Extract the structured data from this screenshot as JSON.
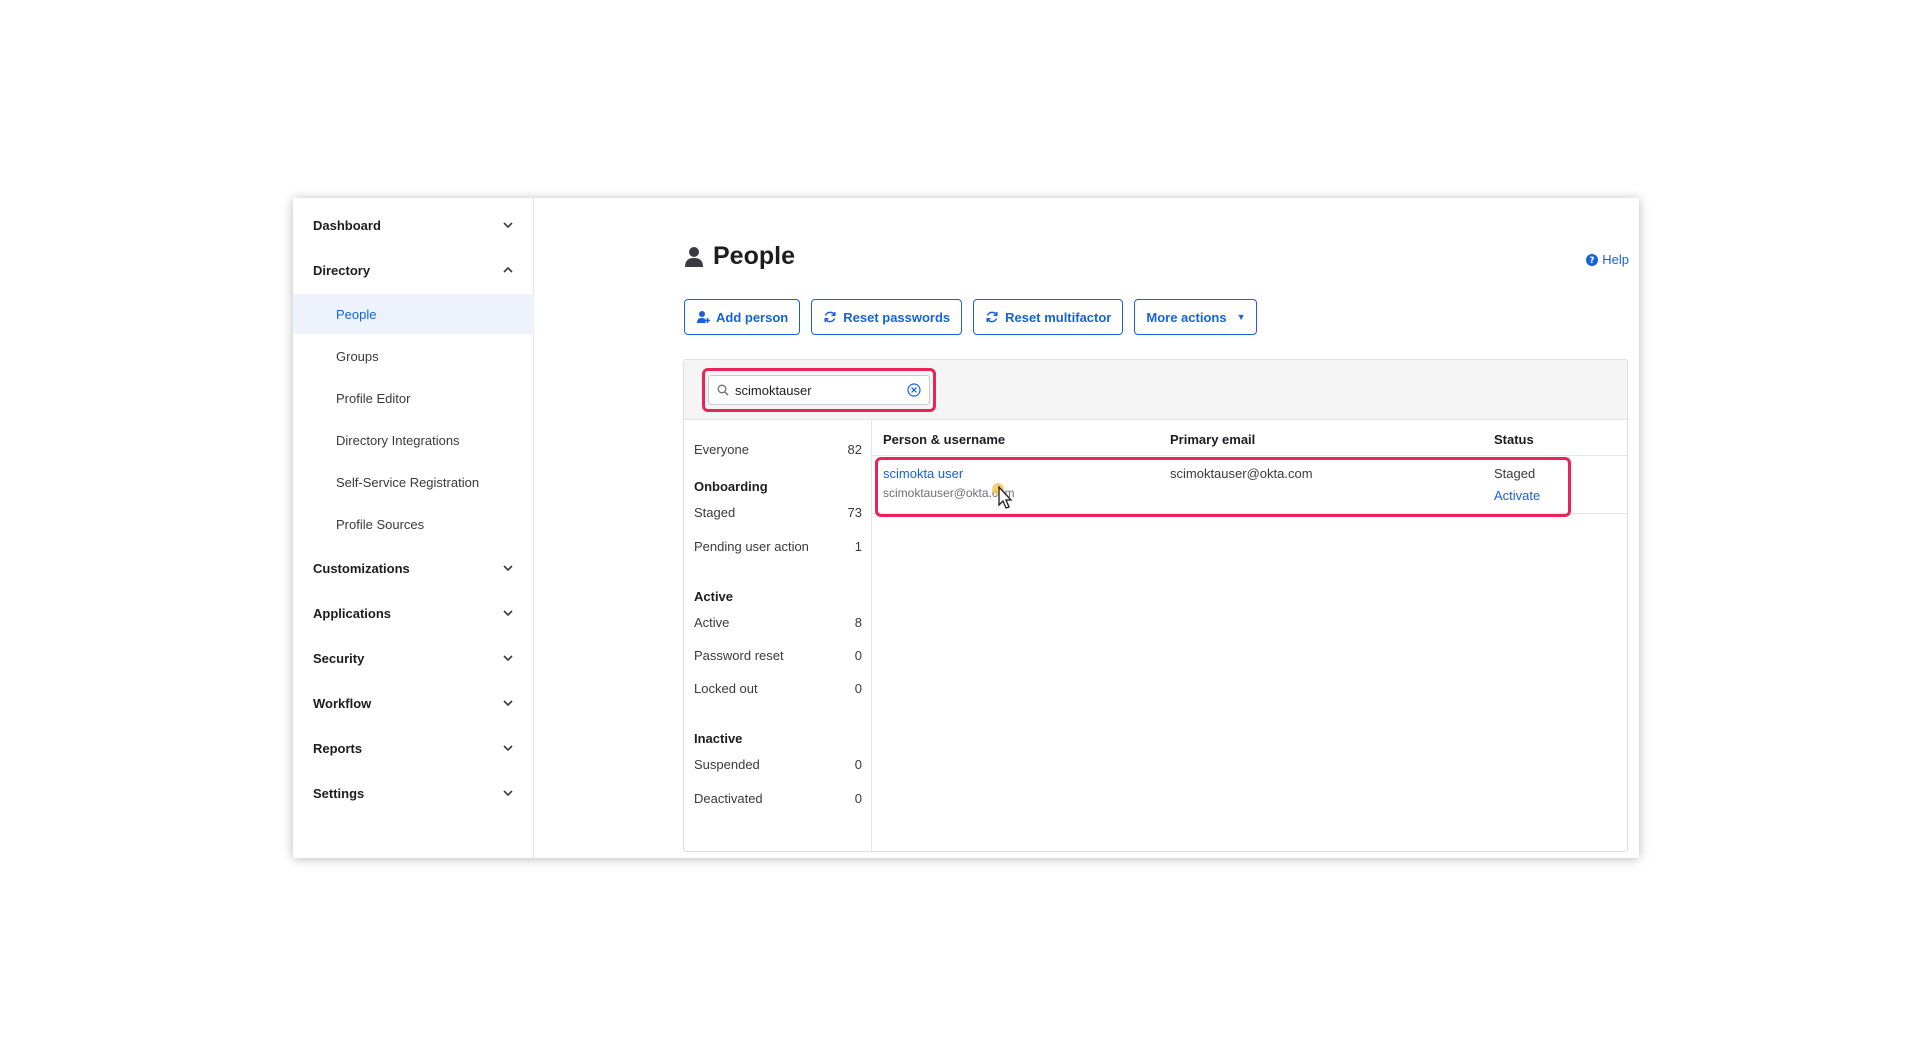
{
  "sidebar": {
    "sections": [
      {
        "label": "Dashboard"
      },
      {
        "label": "Directory"
      },
      {
        "label": "Customizations"
      },
      {
        "label": "Applications"
      },
      {
        "label": "Security"
      },
      {
        "label": "Workflow"
      },
      {
        "label": "Reports"
      },
      {
        "label": "Settings"
      }
    ],
    "directory_items": [
      {
        "label": "People"
      },
      {
        "label": "Groups"
      },
      {
        "label": "Profile Editor"
      },
      {
        "label": "Directory Integrations"
      },
      {
        "label": "Self-Service Registration"
      },
      {
        "label": "Profile Sources"
      }
    ],
    "active_item": "People"
  },
  "header": {
    "title": "People",
    "help_label": "Help",
    "title_icon": "person-icon",
    "help_icon": "question-circle-icon"
  },
  "toolbar": {
    "add_person": "Add person",
    "reset_passwords": "Reset passwords",
    "reset_multifactor": "Reset multifactor",
    "more_actions": "More actions",
    "more_actions_caret": "▼"
  },
  "search": {
    "value": "scimoktauser",
    "placeholder": "Search"
  },
  "filters": {
    "everyone": {
      "label": "Everyone",
      "count": "82"
    },
    "onboarding": {
      "heading": "Onboarding",
      "items": [
        {
          "label": "Staged",
          "count": "73"
        },
        {
          "label": "Pending user action",
          "count": "1"
        }
      ]
    },
    "active": {
      "heading": "Active",
      "items": [
        {
          "label": "Active",
          "count": "8"
        },
        {
          "label": "Password reset",
          "count": "0"
        },
        {
          "label": "Locked out",
          "count": "0"
        }
      ]
    },
    "inactive": {
      "heading": "Inactive",
      "items": [
        {
          "label": "Suspended",
          "count": "0"
        },
        {
          "label": "Deactivated",
          "count": "0"
        }
      ]
    }
  },
  "table": {
    "columns": [
      "Person & username",
      "Primary email",
      "Status"
    ],
    "rows": [
      {
        "name": "scimokta user",
        "username": "scimoktauser@okta.com",
        "email": "scimoktauser@okta.com",
        "status": "Staged",
        "action": "Activate"
      }
    ]
  },
  "colors": {
    "accent": "#1662dd",
    "highlight": "#e8245a",
    "active_bg": "#eef2fd"
  }
}
